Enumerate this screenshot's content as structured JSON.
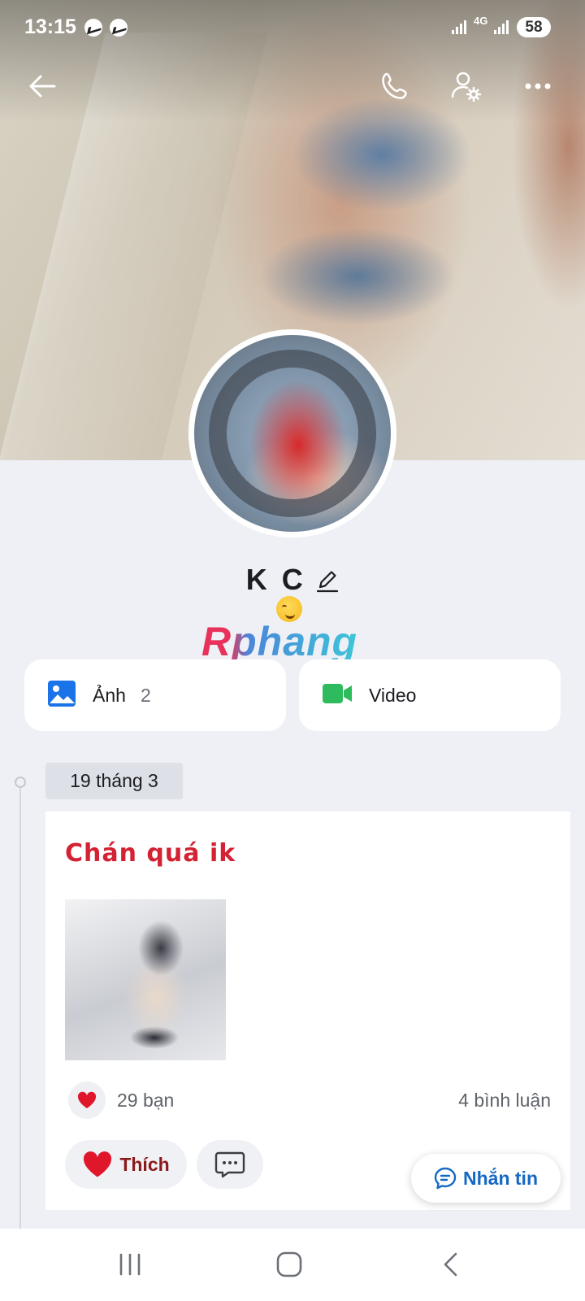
{
  "status_bar": {
    "time": "13:15",
    "network": "4G",
    "battery": "58",
    "notification_icons": [
      "messenger-icon",
      "messenger-icon"
    ]
  },
  "profile": {
    "name": "K C",
    "status_emoji": "savoring-food-emoji",
    "watermark": "Rphang"
  },
  "media": {
    "photos": {
      "label": "Ảnh",
      "count": "2",
      "icon": "image-icon",
      "color": "#1a73e8"
    },
    "videos": {
      "label": "Video",
      "icon": "video-camera-icon",
      "color": "#2dbb5d"
    }
  },
  "timeline": {
    "date": "19 tháng 3",
    "post": {
      "text": "Chán quá ik",
      "likes": "29 bạn",
      "comments": "4 bình luận",
      "like_label": "Thích"
    }
  },
  "fab": {
    "label": "Nhắn tin"
  },
  "colors": {
    "accent_blue": "#1568c4",
    "post_text_red": "#d32233",
    "background": "#eef0f5"
  }
}
